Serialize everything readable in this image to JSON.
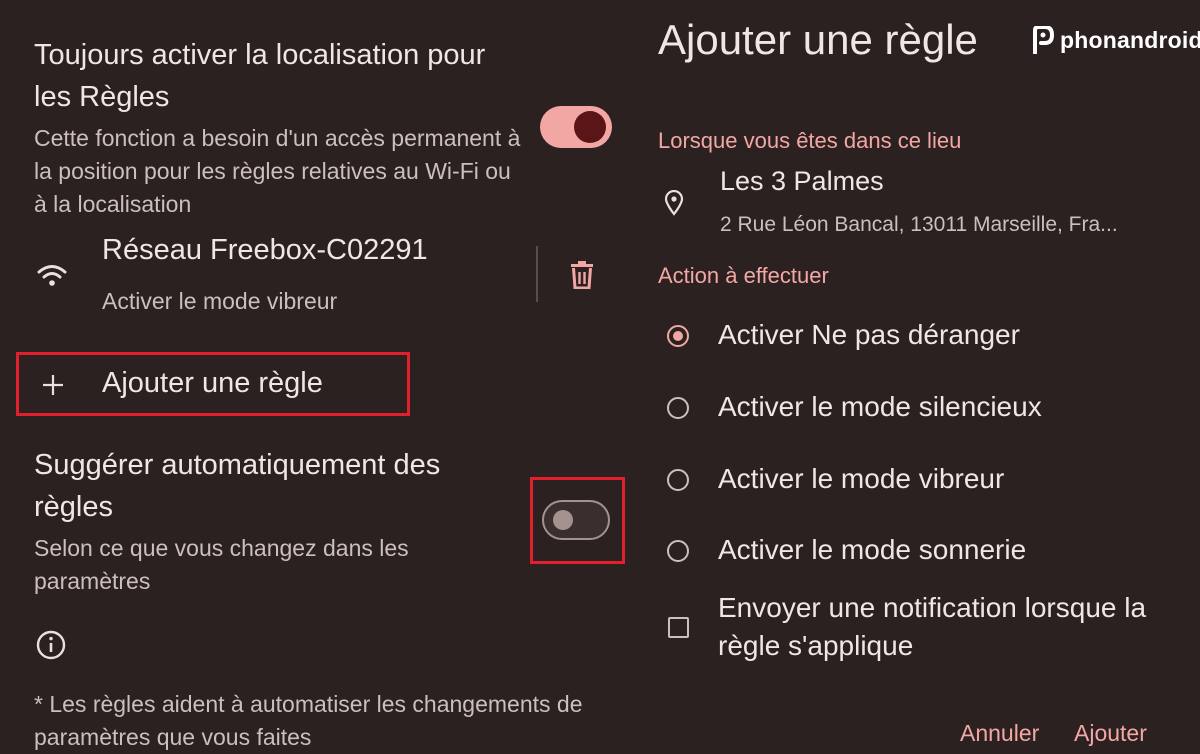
{
  "left": {
    "location_setting": {
      "title": "Toujours activer la localisation pour les Règles",
      "description": "Cette fonction a besoin d'un accès permanent à la position pour les règles relatives au Wi-Fi ou à la localisation",
      "enabled": true
    },
    "rule": {
      "title": "Réseau Freebox-C02291",
      "subtitle": "Activer le mode vibreur",
      "icon": "wifi-icon"
    },
    "add_rule": {
      "label": "Ajouter une règle",
      "icon": "plus-icon"
    },
    "suggest_setting": {
      "title": "Suggérer automatiquement des règles",
      "description": "Selon ce que vous changez dans les paramètres",
      "enabled": false
    },
    "footnote": "* Les règles aident à automatiser les changements de paramètres que vous faites"
  },
  "dialog": {
    "title": "Ajouter une règle",
    "location_label": "Lorsque vous êtes dans ce lieu",
    "place_name": "Les 3 Palmes",
    "place_address": "2 Rue Léon Bancal, 13011 Marseille, Fra...",
    "action_label": "Action à effectuer",
    "options": [
      {
        "label": "Activer Ne pas déranger",
        "selected": true
      },
      {
        "label": "Activer le mode silencieux",
        "selected": false
      },
      {
        "label": "Activer le mode vibreur",
        "selected": false
      },
      {
        "label": "Activer le mode sonnerie",
        "selected": false
      }
    ],
    "notify_checkbox": {
      "label": "Envoyer une notification lorsque la règle s'applique",
      "checked": false
    },
    "cancel_label": "Annuler",
    "confirm_label": "Ajouter"
  },
  "watermark": "phonandroid",
  "colors": {
    "background": "#2b2120",
    "accent": "#f3a7a5",
    "toggle_knob_on": "#5a1617",
    "highlight_box": "#e0202a"
  }
}
